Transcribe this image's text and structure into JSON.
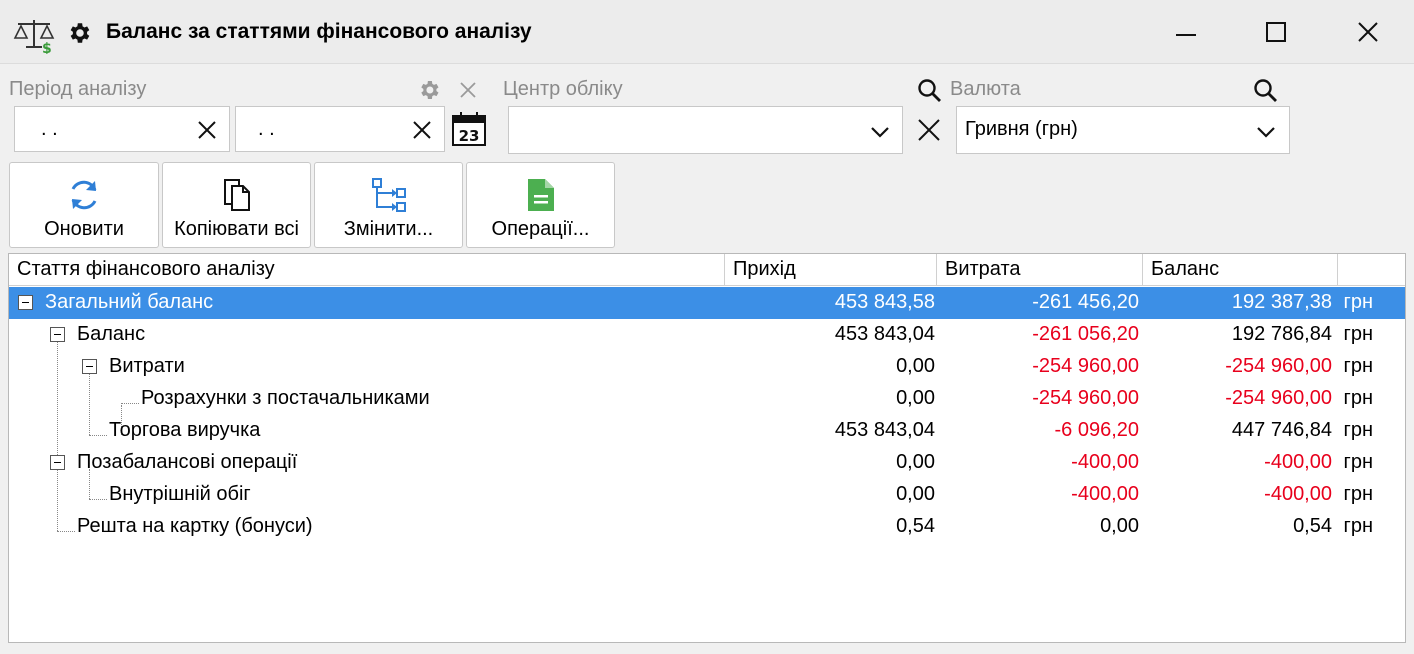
{
  "window": {
    "title": "Баланс за статтями фінансового аналізу",
    "icons": [
      "scales-icon",
      "gear-icon",
      "minimize-icon",
      "maximize-icon",
      "close-icon"
    ]
  },
  "filters": {
    "period_label": "Період аналізу",
    "date_from": ". .",
    "date_to": ". .",
    "center_label": "Центр обліку",
    "center_value": "",
    "currency_label": "Валюта",
    "currency_value": "Гривня (грн)",
    "calendar_day": "23"
  },
  "toolbar": {
    "refresh_label": "Оновити",
    "copy_all_label": "Копіювати всі",
    "change_label": "Змінити...",
    "operations_label": "Операції..."
  },
  "grid": {
    "columns": [
      "Стаття фінансового аналізу",
      "Прихід",
      "Витрата",
      "Баланс"
    ],
    "rows": [
      {
        "name": "Загальний баланс",
        "income": "453 843,58",
        "expense": "-261 456,20",
        "balance": "192 387,38",
        "currency": "грн"
      },
      {
        "name": "Баланс",
        "income": "453 843,04",
        "expense": "-261 056,20",
        "balance": "192 786,84",
        "currency": "грн"
      },
      {
        "name": "Витрати",
        "income": "0,00",
        "expense": "-254 960,00",
        "balance": "-254 960,00",
        "currency": "грн"
      },
      {
        "name": "Розрахунки з постачальниками",
        "income": "0,00",
        "expense": "-254 960,00",
        "balance": "-254 960,00",
        "currency": "грн"
      },
      {
        "name": "Торгова виручка",
        "income": "453 843,04",
        "expense": "-6 096,20",
        "balance": "447 746,84",
        "currency": "грн"
      },
      {
        "name": "Позабалансові операції",
        "income": "0,00",
        "expense": "-400,00",
        "balance": "-400,00",
        "currency": "грн"
      },
      {
        "name": "Внутрішній обіг",
        "income": "0,00",
        "expense": "-400,00",
        "balance": "-400,00",
        "currency": "грн"
      },
      {
        "name": "Решта на картку (бонуси)",
        "income": "0,54",
        "expense": "0,00",
        "balance": "0,54",
        "currency": "грн"
      }
    ]
  },
  "colors": {
    "selection": "#3c8fe6",
    "negative": "#e8001c",
    "refresh_icon": "#2f7fd6",
    "operations_icon": "#4caf50"
  }
}
